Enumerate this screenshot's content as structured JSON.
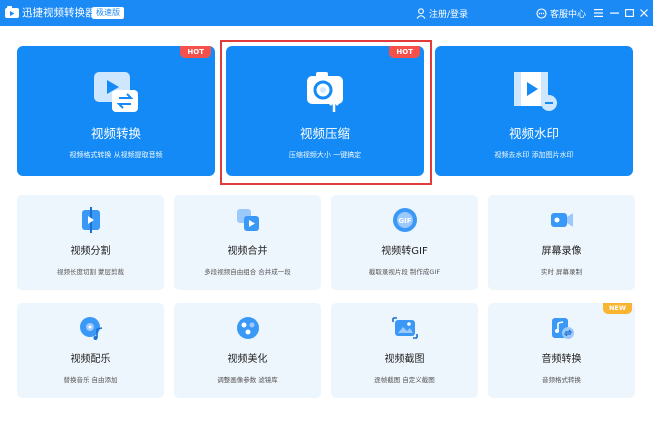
{
  "titlebar": {
    "app_title": "迅捷视频转换器",
    "edition_badge": "极速版",
    "login_label": "注册/登录",
    "support_label": "客服中心"
  },
  "big_cards": [
    {
      "title": "视频转换",
      "desc": "视频格式转换 从视频提取音频",
      "badge": "HOT"
    },
    {
      "title": "视频压缩",
      "desc": "压缩视频大小 一键搞定",
      "badge": "HOT"
    },
    {
      "title": "视频水印",
      "desc": "视频去水印 添加图片水印",
      "badge": ""
    }
  ],
  "small_cards": [
    {
      "title": "视频分割",
      "desc": "视频长度切割 蒙层剪裁",
      "badge": ""
    },
    {
      "title": "视频合并",
      "desc": "多段视频自由组合 合并成一段",
      "badge": ""
    },
    {
      "title": "视频转GIF",
      "desc": "截取录视片段 制作成GIF",
      "badge": ""
    },
    {
      "title": "屏幕录像",
      "desc": "实时 屏幕录制",
      "badge": ""
    },
    {
      "title": "视频配乐",
      "desc": "替换音乐 自由添加",
      "badge": ""
    },
    {
      "title": "视频美化",
      "desc": "调整画像参数 滤镜库",
      "badge": ""
    },
    {
      "title": "视频截图",
      "desc": "逐帧截图 自定义截图",
      "badge": ""
    },
    {
      "title": "音频转换",
      "desc": "音频格式转换",
      "badge": "NEW"
    }
  ],
  "colors": {
    "titlebar": "#1c8af4",
    "card_blue": "#138af5",
    "small_card_bg": "#eef6fd",
    "hot_badge": "#f5504b",
    "new_badge": "#f9b52f",
    "selection_border": "#e23b3b"
  },
  "icons": {
    "titlebar": [
      "app-logo-icon",
      "user-icon",
      "headset-icon",
      "menu-icon",
      "minimize-icon",
      "maximize-icon",
      "close-icon"
    ],
    "big_cards": [
      "video-convert-icon",
      "video-compress-icon",
      "video-watermark-icon"
    ],
    "small_cards": [
      "video-split-icon",
      "video-merge-icon",
      "video-gif-icon",
      "screen-record-icon",
      "video-music-icon",
      "video-beautify-icon",
      "video-screenshot-icon",
      "audio-convert-icon"
    ]
  },
  "selected_card": "视频压缩"
}
